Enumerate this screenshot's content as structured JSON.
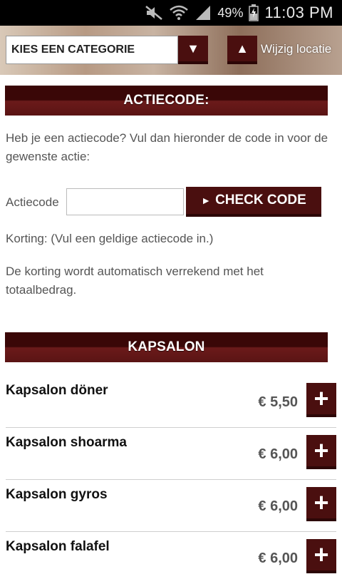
{
  "status_bar": {
    "battery": "49%",
    "time": "11:03 PM",
    "icons": [
      "mute-icon",
      "wifi-icon",
      "signal-icon",
      "battery-icon"
    ]
  },
  "header": {
    "category_select": "KIES EEN CATEGORIE",
    "category_arrow": "▼",
    "location_arrow": "▲",
    "location_label": "Wijzig locatie"
  },
  "promo": {
    "title": "ACTIECODE:",
    "intro": "Heb je een actiecode? Vul dan hieronder de code in voor de gewenste actie:",
    "code_label": "Actiecode",
    "code_value": "",
    "check_button": "CHECK CODE",
    "discount_text": "Korting: (Vul een geldige actiecode in.)",
    "auto_text": "De korting wordt automatisch verrekend met het totaalbedrag."
  },
  "section": {
    "title": "KAPSALON"
  },
  "products": [
    {
      "name": "Kapsalon döner",
      "price": "€ 5,50"
    },
    {
      "name": "Kapsalon shoarma",
      "price": "€ 6,00"
    },
    {
      "name": "Kapsalon gyros",
      "price": "€ 6,00"
    },
    {
      "name": "Kapsalon falafel",
      "price": "€ 6,00"
    }
  ],
  "colors": {
    "accent": "#4a0f0f",
    "banner_dark": "#3a0707",
    "text_muted": "#555555"
  }
}
